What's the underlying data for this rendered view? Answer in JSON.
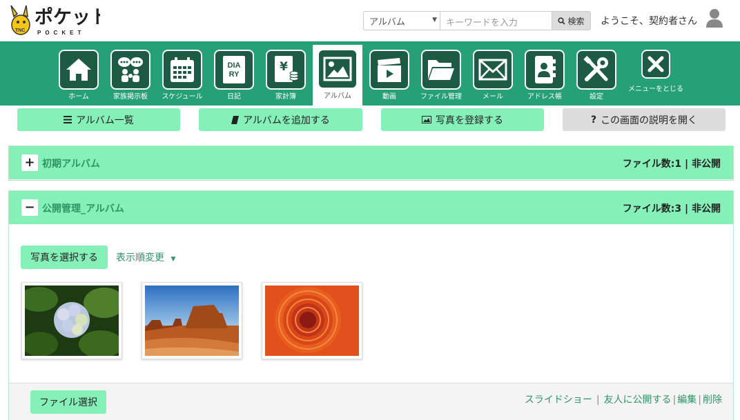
{
  "header": {
    "search_category": "アルバム",
    "search_placeholder": "キーワードを入力",
    "search_button": "検索",
    "welcome": "ようこそ、契約者さん"
  },
  "nav": [
    {
      "label": "ホーム",
      "icon": "home-icon"
    },
    {
      "label": "家族掲示板",
      "icon": "family-board-icon"
    },
    {
      "label": "スケジュール",
      "icon": "calendar-icon"
    },
    {
      "label": "日記",
      "icon": "diary-icon",
      "icon_text": [
        "DIA",
        "RY"
      ]
    },
    {
      "label": "家計簿",
      "icon": "household-account-icon",
      "icon_text": [
        "¥"
      ]
    },
    {
      "label": "アルバム",
      "icon": "album-icon",
      "active": true
    },
    {
      "label": "動画",
      "icon": "video-icon"
    },
    {
      "label": "ファイル管理",
      "icon": "folder-icon"
    },
    {
      "label": "メール",
      "icon": "mail-icon"
    },
    {
      "label": "アドレス帳",
      "icon": "address-book-icon"
    },
    {
      "label": "設定",
      "icon": "settings-icon"
    },
    {
      "label": "メニューをとじる",
      "icon": "close-icon"
    }
  ],
  "actions": {
    "album_list": "アルバム一覧",
    "add_album": "アルバムを追加する",
    "register_photo": "写真を登録する",
    "open_help": "この画面の説明を開く"
  },
  "albums": [
    {
      "title": "初期アルバム",
      "meta": "ファイル数:1 | 非公開",
      "toggle": "+"
    },
    {
      "title": "公開管理_アルバム",
      "meta": "ファイル数:3 | 非公開",
      "toggle": "−"
    }
  ],
  "album_body": {
    "select_photos": "写真を選択する",
    "sort_order": "表示順変更",
    "file_select": "ファイル選択",
    "links": {
      "slideshow": "スライドショー",
      "share": "友人に公開する",
      "edit": "編集",
      "delete": "削除"
    },
    "thumbnails": [
      "hydrangea-photo",
      "desert-mesa-photo",
      "orange-flower-photo"
    ]
  },
  "colors": {
    "nav_green": "#26a077",
    "icon_dark": "#1e5b45",
    "mint": "#86f0b9",
    "text_green": "#2e9464"
  }
}
